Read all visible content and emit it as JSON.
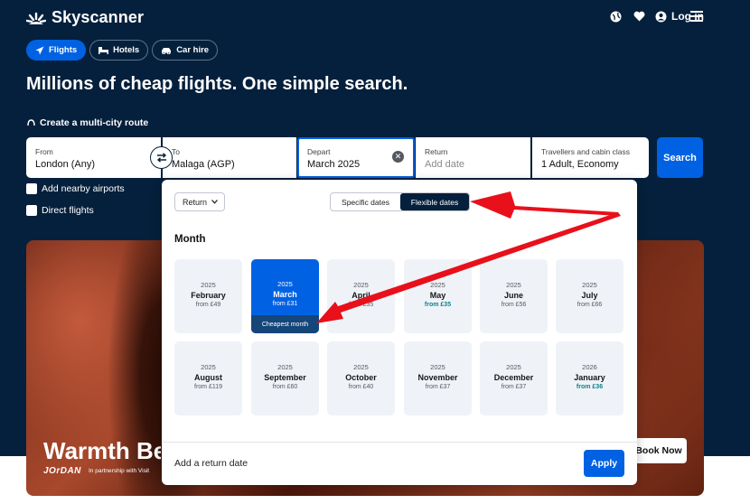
{
  "brand": {
    "name": "Skyscanner"
  },
  "header": {
    "login_label": "Log in",
    "icons": [
      "globe-icon",
      "heart-icon",
      "user-icon",
      "menu-icon"
    ]
  },
  "tabs": [
    {
      "label": "Flights",
      "icon": "plane-icon",
      "active": true
    },
    {
      "label": "Hotels",
      "icon": "bed-icon",
      "active": false
    },
    {
      "label": "Car hire",
      "icon": "car-icon",
      "active": false
    }
  ],
  "headline": "Millions of cheap flights. One simple search.",
  "multicity_label": "Create a multi-city route",
  "search": {
    "from": {
      "label": "From",
      "value": "London (Any)"
    },
    "to": {
      "label": "To",
      "value": "Malaga (AGP)"
    },
    "depart": {
      "label": "Depart",
      "value": "March 2025"
    },
    "return": {
      "label": "Return",
      "placeholder": "Add date"
    },
    "travellers": {
      "label": "Travellers and cabin class",
      "value": "1 Adult, Economy"
    },
    "button_label": "Search"
  },
  "options": {
    "nearby_airports": "Add nearby airports",
    "direct_flights": "Direct flights"
  },
  "promo": {
    "title": "Warmth Be",
    "brand": "JOrDAN",
    "subtitle": "In partnership with Visit",
    "cta": "Book Now"
  },
  "datepicker": {
    "trip_type": "Return",
    "mode_options": [
      "Specific dates",
      "Flexible dates"
    ],
    "selected_mode": "Flexible dates",
    "section_title": "Month",
    "months": [
      {
        "year": "2025",
        "month": "February",
        "price": "from £49",
        "selected": false,
        "cheap": false
      },
      {
        "year": "2025",
        "month": "March",
        "price": "from £31",
        "selected": true,
        "cheap": false,
        "tag": "Cheapest month"
      },
      {
        "year": "2025",
        "month": "April",
        "price": "from £35",
        "selected": false,
        "cheap": false
      },
      {
        "year": "2025",
        "month": "May",
        "price": "from £35",
        "selected": false,
        "cheap": true
      },
      {
        "year": "2025",
        "month": "June",
        "price": "from £56",
        "selected": false,
        "cheap": false
      },
      {
        "year": "2025",
        "month": "July",
        "price": "from £66",
        "selected": false,
        "cheap": false
      },
      {
        "year": "2025",
        "month": "August",
        "price": "from £119",
        "selected": false,
        "cheap": false
      },
      {
        "year": "2025",
        "month": "September",
        "price": "from £60",
        "selected": false,
        "cheap": false
      },
      {
        "year": "2025",
        "month": "October",
        "price": "from £40",
        "selected": false,
        "cheap": false
      },
      {
        "year": "2025",
        "month": "November",
        "price": "from £37",
        "selected": false,
        "cheap": false
      },
      {
        "year": "2025",
        "month": "December",
        "price": "from £37",
        "selected": false,
        "cheap": false
      },
      {
        "year": "2026",
        "month": "January",
        "price": "from £36",
        "selected": false,
        "cheap": true
      }
    ],
    "add_return_label": "Add a return date",
    "apply_label": "Apply"
  },
  "colors": {
    "navy": "#05203c",
    "blue": "#0062e3",
    "arrow": "#e8101a",
    "green_price": "#0c838a"
  }
}
